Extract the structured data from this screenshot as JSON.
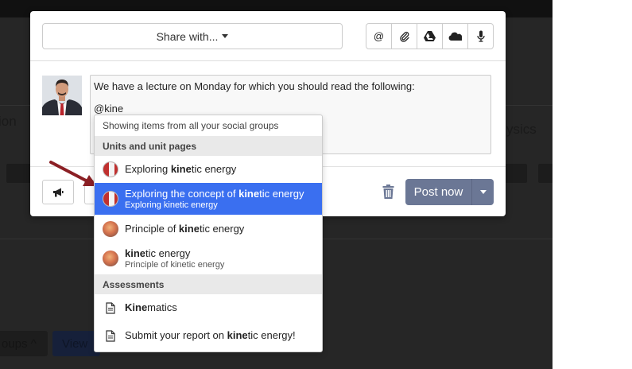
{
  "backdrop": {
    "left_text": "ion",
    "right_text": "ysics",
    "groups_label": "oups",
    "view_label": "View"
  },
  "header": {
    "share_label": "Share with...",
    "tools": [
      {
        "icon": "at-icon",
        "glyph": "@"
      },
      {
        "icon": "paperclip-icon"
      },
      {
        "icon": "google-drive-icon"
      },
      {
        "icon": "onedrive-icon"
      },
      {
        "icon": "microphone-icon"
      }
    ]
  },
  "composer": {
    "line1": "We have a lecture on Monday for which you should read the following:",
    "line2": "@kine"
  },
  "footer": {
    "post_label": "Post now"
  },
  "colors": {
    "accent_selected": "#3a6ff0",
    "post_button": "#6b7795"
  },
  "dropdown": {
    "info": "Showing items from all your social groups",
    "sections": [
      {
        "title": "Units and unit pages",
        "items": [
          {
            "pre": "Exploring ",
            "match": "kine",
            "post": "tic energy",
            "sub": "",
            "icon": "unit-icon",
            "selected": false
          },
          {
            "pre": "Exploring the concept of ",
            "match": "kine",
            "post": "tic energy",
            "sub": "Exploring kinetic energy",
            "icon": "unit-icon",
            "selected": true
          },
          {
            "pre": "Principle of ",
            "match": "kine",
            "post": "tic energy",
            "sub": "",
            "icon": "page-icon",
            "selected": false
          },
          {
            "pre": "",
            "match": "kine",
            "post": "tic energy",
            "sub": "Principle of kinetic energy",
            "icon": "page-icon",
            "selected": false
          }
        ]
      },
      {
        "title": "Assessments",
        "items": [
          {
            "pre": "",
            "match": "Kine",
            "post": "matics",
            "sub": "",
            "icon": "document-icon",
            "selected": false
          },
          {
            "pre": "Submit your report on ",
            "match": "kine",
            "post": "tic energy!",
            "sub": "",
            "icon": "document-icon",
            "selected": false
          }
        ]
      }
    ]
  }
}
